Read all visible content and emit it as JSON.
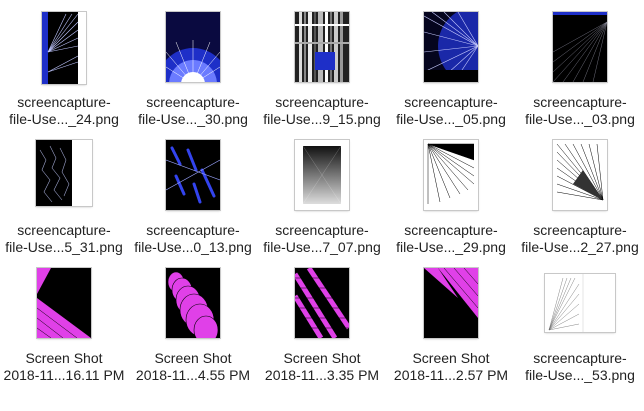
{
  "files": [
    {
      "line1": "screencapture-",
      "line2": "file-Use..._24.png",
      "thumb": "blue-rays-narrow-thumbnail"
    },
    {
      "line1": "screencapture-",
      "line2": "file-Use..._30.png",
      "thumb": "blue-radial-fan-thumbnail"
    },
    {
      "line1": "screencapture-",
      "line2": "file-Use...9_15.png",
      "thumb": "gray-stripes-thumbnail"
    },
    {
      "line1": "screencapture-",
      "line2": "file-Use..._05.png",
      "thumb": "blue-sunburst-thumbnail"
    },
    {
      "line1": "screencapture-",
      "line2": "file-Use..._03.png",
      "thumb": "dark-rays-thumbnail"
    },
    {
      "line1": "screencapture-",
      "line2": "file-Use...5_31.png",
      "thumb": "dark-noise-narrow-thumbnail"
    },
    {
      "line1": "screencapture-",
      "line2": "file-Use...0_13.png",
      "thumb": "blue-scribble-thumbnail"
    },
    {
      "line1": "screencapture-",
      "line2": "file-Use...7_07.png",
      "thumb": "gray-gradient-lines-thumbnail"
    },
    {
      "line1": "screencapture-",
      "line2": "file-Use..._29.png",
      "thumb": "black-fan-lines-thumbnail"
    },
    {
      "line1": "screencapture-",
      "line2": "file-Use...2_27.png",
      "thumb": "black-diagonal-lines-thumbnail"
    },
    {
      "line1": "Screen Shot",
      "line2": "2018-11...16.11 PM",
      "thumb": "magenta-diagonal-thumbnail"
    },
    {
      "line1": "Screen Shot",
      "line2": "2018-11...4.55 PM",
      "thumb": "magenta-circles-thumbnail"
    },
    {
      "line1": "Screen Shot",
      "line2": "2018-11...3.35 PM",
      "thumb": "magenta-stripes-thumbnail"
    },
    {
      "line1": "Screen Shot",
      "line2": "2018-11...2.57 PM",
      "thumb": "magenta-wedge-thumbnail"
    },
    {
      "line1": "screencapture-",
      "line2": "file-Use..._53.png",
      "thumb": "gray-lines-white-thumbnail"
    }
  ],
  "colors": {
    "blue": "#2233cc",
    "magenta": "#e040e8",
    "black": "#000000",
    "label": "#222222"
  }
}
